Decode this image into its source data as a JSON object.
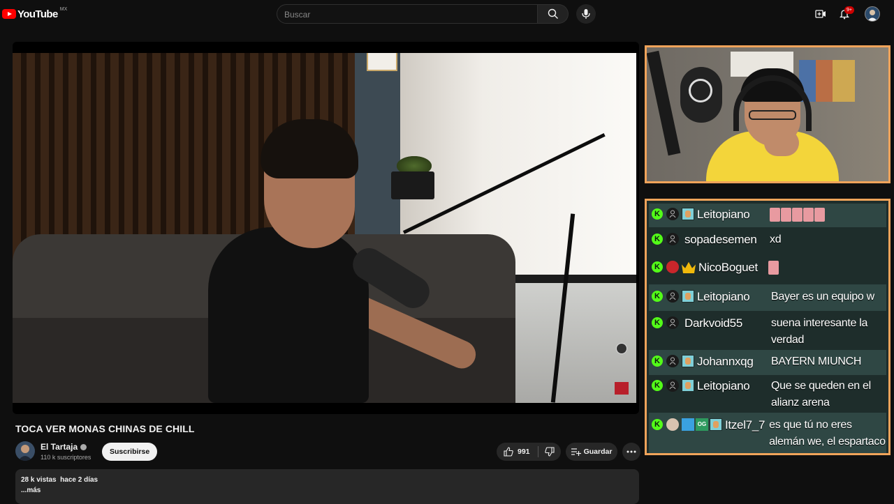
{
  "header": {
    "logo_text": "YouTube",
    "logo_country": "MX",
    "search_placeholder": "Buscar",
    "notification_count": "9+",
    "icons": [
      "search-icon",
      "mic-icon",
      "create-icon",
      "bell-icon",
      "avatar"
    ]
  },
  "video": {
    "title": "TOCA VER MONAS CHINAS DE CHILL"
  },
  "channel": {
    "name": "El Tartaja",
    "subscribers": "110 k suscriptores",
    "subscribe_label": "Suscribirse"
  },
  "actions": {
    "likes": "991",
    "save_label": "Guardar"
  },
  "description": {
    "views": "28 k vistas",
    "date": "hace 2 días",
    "more_label": "...más"
  },
  "chat": {
    "messages": [
      {
        "user": "Leitopiano",
        "text": ""
      },
      {
        "user": "sopadesemen",
        "text": "xd"
      },
      {
        "user": "NicoBoguet",
        "text": ""
      },
      {
        "user": "Leitopiano",
        "text": "Bayer es un equipo w"
      },
      {
        "user": "Darkvoid55",
        "text": "suena interesante la verdad"
      },
      {
        "user": "Johannxqg",
        "text": "BAYERN MIUNCH"
      },
      {
        "user": "Leitopiano",
        "text": "Que se queden en el alianz arena"
      },
      {
        "user": "Itzel7_7",
        "text": "es que tú no eres alemán we, el espartaco si"
      }
    ],
    "badge_letter": "K"
  },
  "colors": {
    "background": "#0f0f0f",
    "overlay_border": "#f0a35a",
    "chat_bg": "#1e2d2b",
    "chat_alt_bg": "#2f4744",
    "kick_green": "#53fc18",
    "notif_red": "#cc0000"
  }
}
